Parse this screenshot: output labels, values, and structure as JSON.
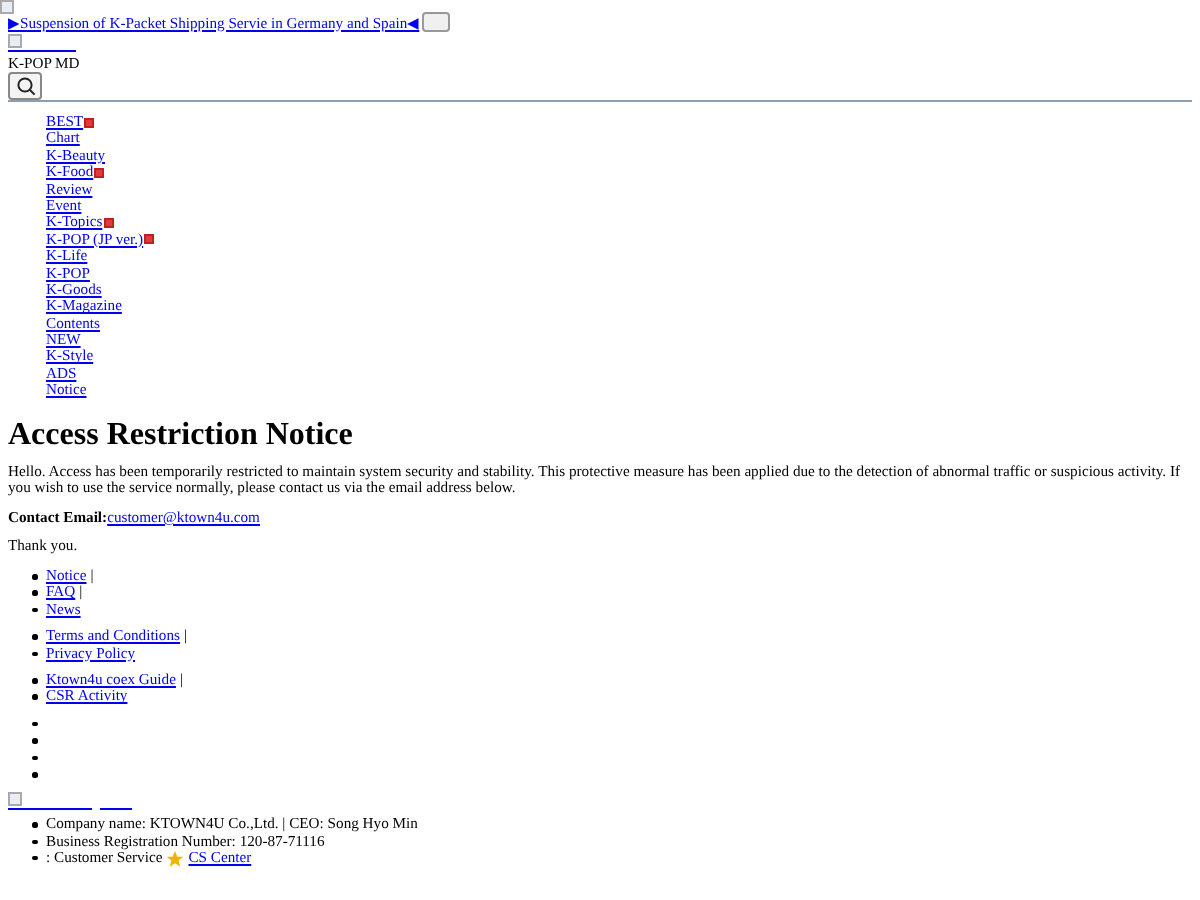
{
  "banner": {
    "link_text": "▶Suspension of K-Packet Shipping Servie in Germany and Spain◀"
  },
  "header": {
    "site_label": "K-POP MD"
  },
  "nav": {
    "items": [
      {
        "label": "BEST",
        "new_badge": true
      },
      {
        "label": "Chart",
        "new_badge": false
      },
      {
        "label": "K-Beauty",
        "new_badge": false
      },
      {
        "label": "K-Food",
        "new_badge": true
      },
      {
        "label": "Review",
        "new_badge": false
      },
      {
        "label": "Event",
        "new_badge": false
      },
      {
        "label": "K-Topics",
        "new_badge": true
      },
      {
        "label": "K-POP (JP ver.)",
        "new_badge": true
      },
      {
        "label": "K-Life",
        "new_badge": false
      },
      {
        "label": "K-POP",
        "new_badge": false
      },
      {
        "label": "K-Goods",
        "new_badge": false
      },
      {
        "label": "K-Magazine",
        "new_badge": false
      },
      {
        "label": "Contents",
        "new_badge": false
      },
      {
        "label": "NEW",
        "new_badge": false
      },
      {
        "label": "K-Style",
        "new_badge": false
      },
      {
        "label": "ADS",
        "new_badge": false
      },
      {
        "label": "Notice",
        "new_badge": false
      }
    ]
  },
  "notice": {
    "title": "Access Restriction Notice",
    "body": "Hello. Access has been temporarily restricted to maintain system security and stability. This protective measure has been applied due to the detection of abnormal traffic or suspicious activity. If you wish to use the service normally, please contact us via the email address below.",
    "contact_label": "Contact Email:",
    "contact_email": "customer@ktown4u.com",
    "closing": "Thank you."
  },
  "footer": {
    "link_groups": [
      [
        {
          "label": "Notice",
          "separator": "|"
        },
        {
          "label": "FAQ",
          "separator": "|"
        },
        {
          "label": "News"
        }
      ],
      [
        {
          "label": "Terms and Conditions",
          "separator": "|"
        },
        {
          "label": "Privacy Policy"
        }
      ],
      [
        {
          "label": "Ktown4u coex Guide",
          "separator": "|"
        },
        {
          "label": "CSR Activity"
        }
      ]
    ],
    "company_info": [
      {
        "kind": "text",
        "text": "Company name: KTOWN4U Co.,Ltd. | CEO: Song Hyo Min"
      },
      {
        "kind": "text",
        "text": "Business Registration Number: 120-87-71116"
      },
      {
        "kind": "service",
        "text": ": Customer Service",
        "link": "CS Center"
      }
    ]
  }
}
